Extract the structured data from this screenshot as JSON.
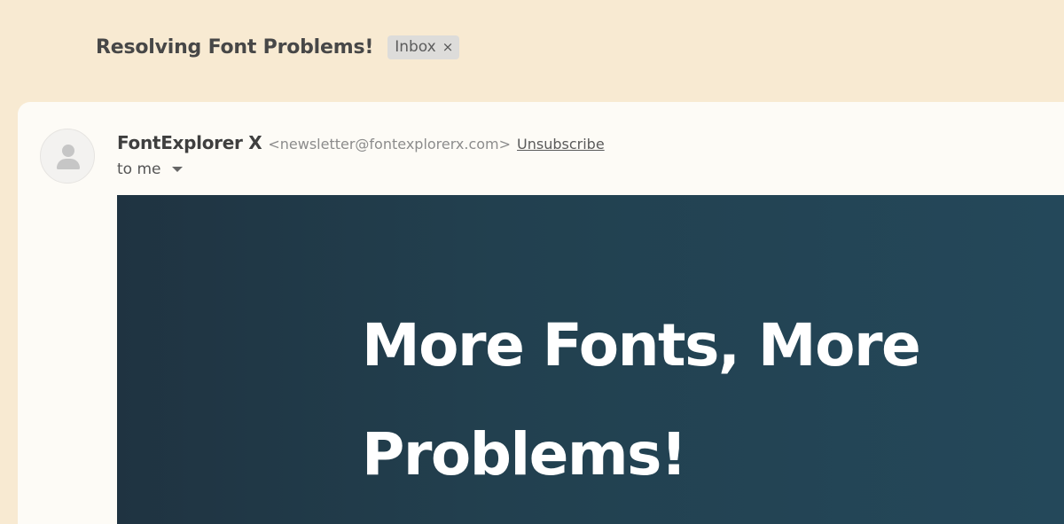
{
  "thread": {
    "subject": "Resolving Font Problems!",
    "label": "Inbox",
    "label_remove_glyph": "×"
  },
  "message": {
    "sender_name": "FontExplorer X",
    "sender_email": "<newsletter@fontexplorerx.com>",
    "unsubscribe_label": "Unsubscribe",
    "recipient_label": "to me",
    "avatar_icon": "person-icon"
  },
  "banner": {
    "headline_line1": "More Fonts, More",
    "headline_line2": "Problems!",
    "colors": {
      "gradient_start": "#1f3341",
      "gradient_end": "#24485a",
      "text": "#ffffff"
    }
  },
  "colors": {
    "app_background": "#f8ead2",
    "card_background": "#fdfbf6",
    "chip_background": "#dddcda"
  }
}
